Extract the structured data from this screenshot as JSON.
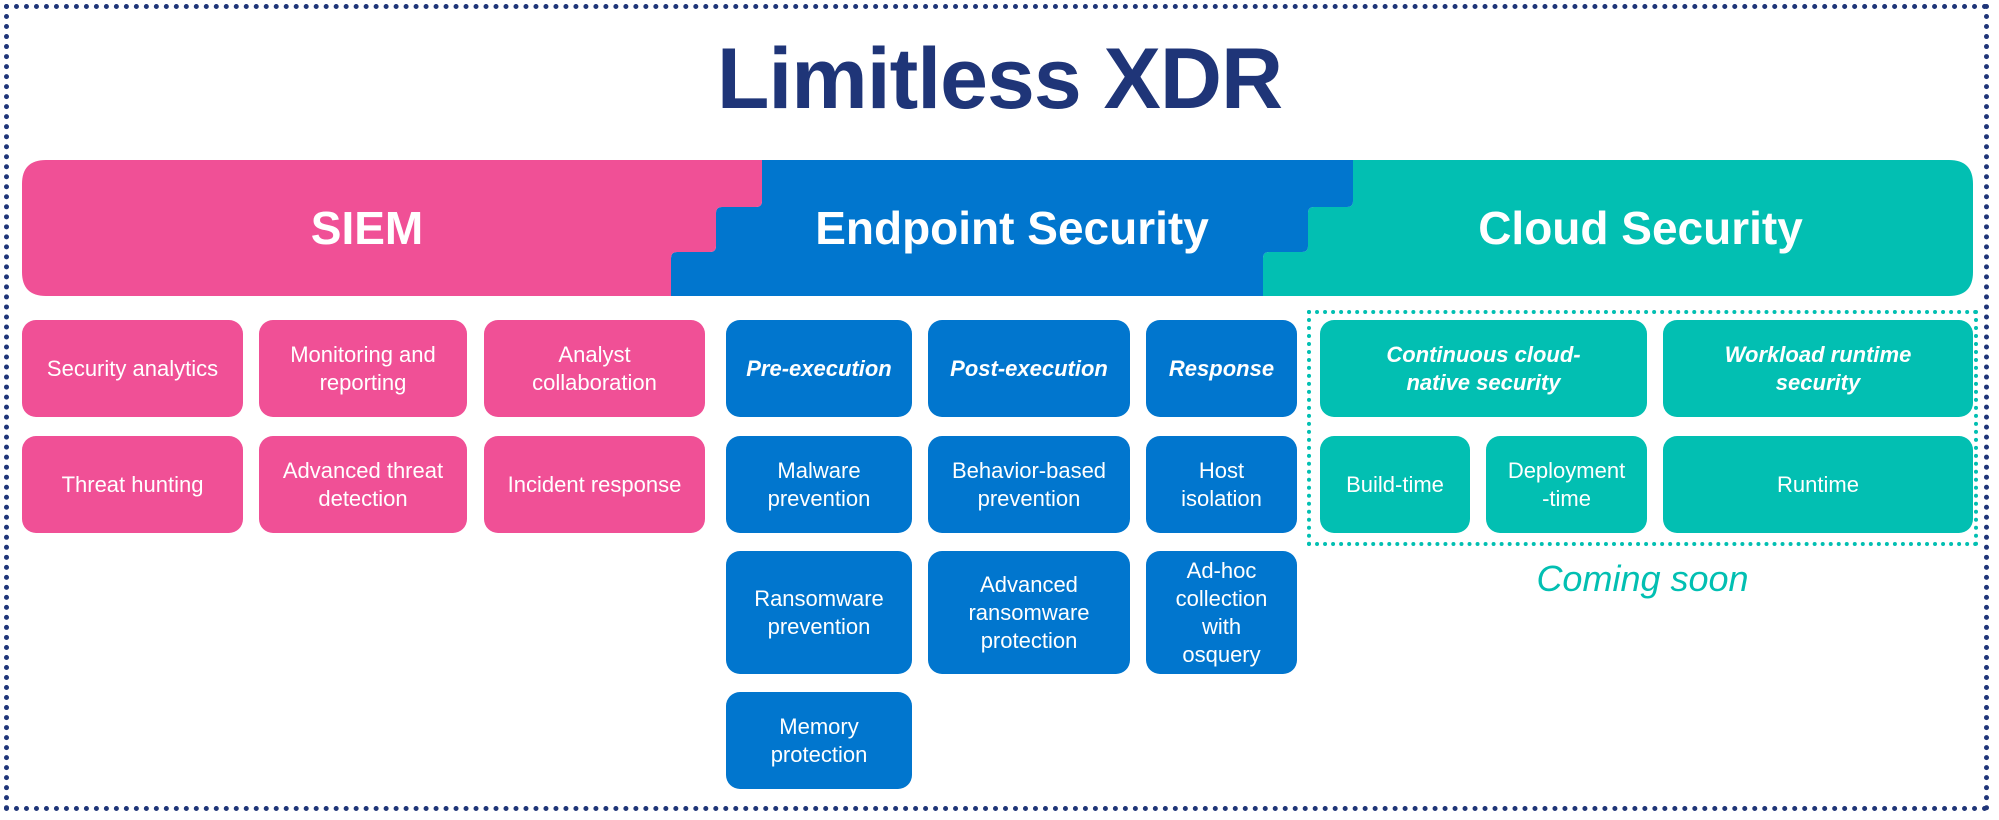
{
  "title": "Limitless XDR",
  "colors": {
    "navy": "#1f3578",
    "siem_pink": "#f05096",
    "endpoint_blue": "#0176ce",
    "cloud_teal": "#02bfb2"
  },
  "siem": {
    "label": "SIEM",
    "items": [
      "Security analytics",
      "Monitoring and reporting",
      "Analyst collaboration",
      "Threat hunting",
      "Advanced threat detection",
      "Incident response"
    ]
  },
  "endpoint": {
    "label": "Endpoint Security",
    "columns": [
      {
        "heading": "Pre-execution",
        "items": [
          "Malware prevention",
          "Ransomware prevention",
          "Memory protection"
        ]
      },
      {
        "heading": "Post-execution",
        "items": [
          "Behavior-based prevention",
          "Advanced ransomware protection"
        ]
      },
      {
        "heading": "Response",
        "items": [
          "Host isolation",
          "Ad-hoc collection with osquery"
        ]
      }
    ]
  },
  "cloud": {
    "label": "Cloud Security",
    "groups": [
      {
        "heading": "Continuous cloud-native security",
        "items": [
          "Build-time",
          "Deployment -time"
        ]
      },
      {
        "heading": "Workload runtime security",
        "items": [
          "Runtime"
        ]
      }
    ],
    "status_note": "Coming soon"
  }
}
